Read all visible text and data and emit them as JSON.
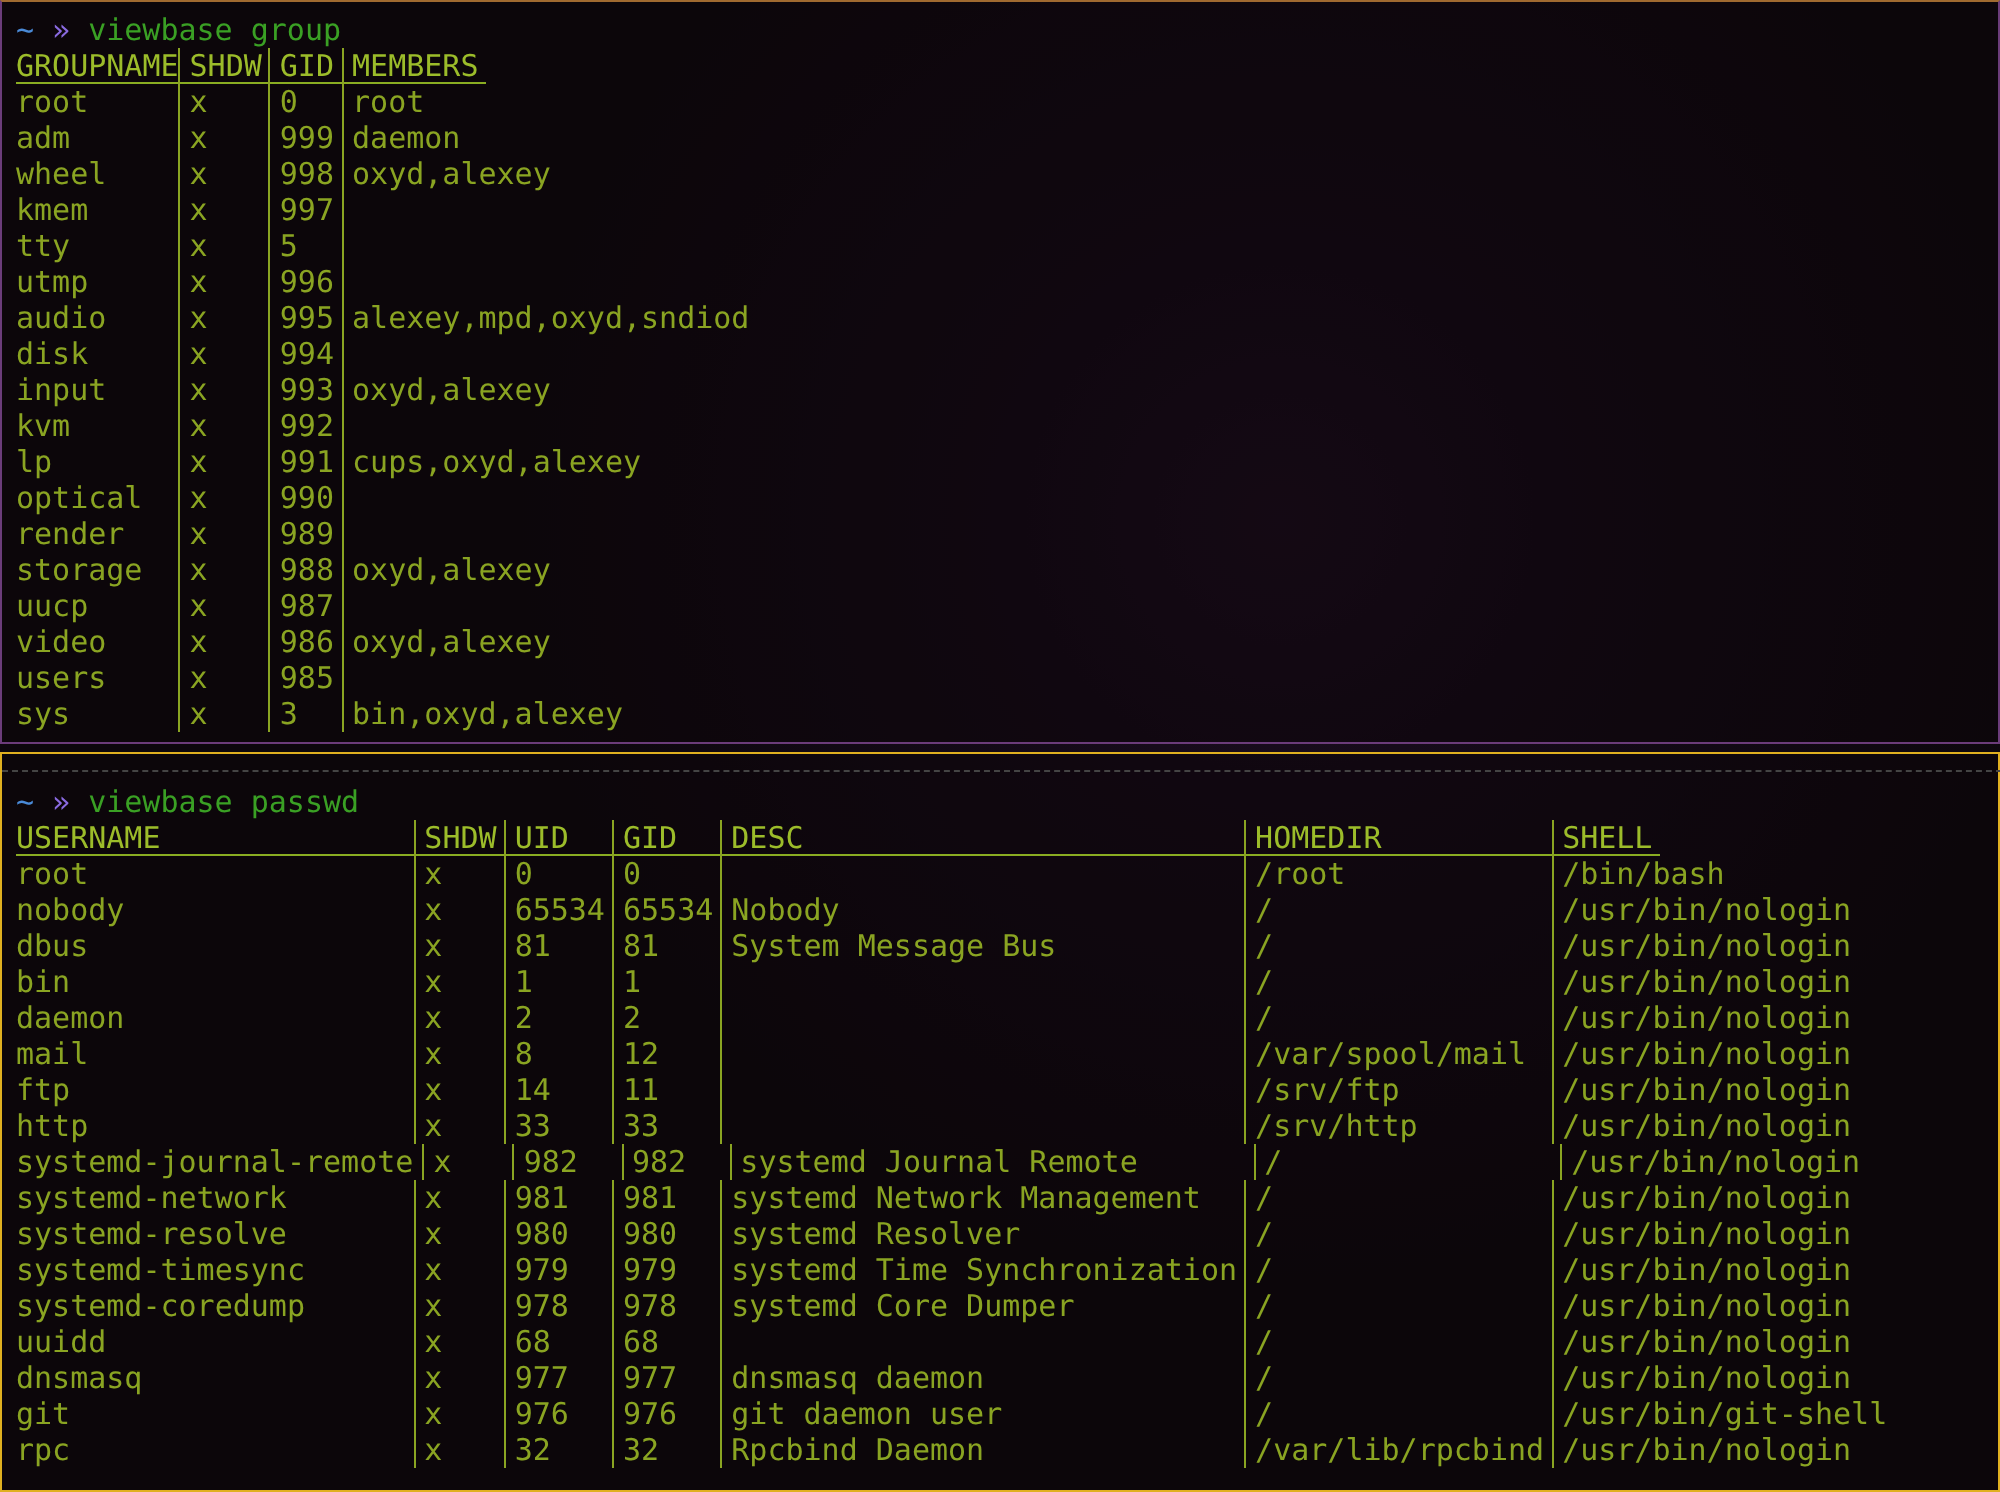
{
  "panes": [
    {
      "focused": false,
      "prompt": {
        "dir": "~",
        "symbol": "»",
        "command": "viewbase group"
      },
      "columns": [
        {
          "label": "GROUPNAME"
        },
        {
          "label": "SHDW"
        },
        {
          "label": "GID"
        },
        {
          "label": "MEMBERS"
        }
      ],
      "rows": [
        [
          "root",
          "x",
          "0",
          "root"
        ],
        [
          "adm",
          "x",
          "999",
          "daemon"
        ],
        [
          "wheel",
          "x",
          "998",
          "oxyd,alexey"
        ],
        [
          "kmem",
          "x",
          "997",
          null
        ],
        [
          "tty",
          "x",
          "5",
          null
        ],
        [
          "utmp",
          "x",
          "996",
          null
        ],
        [
          "audio",
          "x",
          "995",
          "alexey,mpd,oxyd,sndiod"
        ],
        [
          "disk",
          "x",
          "994",
          null
        ],
        [
          "input",
          "x",
          "993",
          "oxyd,alexey"
        ],
        [
          "kvm",
          "x",
          "992",
          null
        ],
        [
          "lp",
          "x",
          "991",
          "cups,oxyd,alexey"
        ],
        [
          "optical",
          "x",
          "990",
          null
        ],
        [
          "render",
          "x",
          "989",
          null
        ],
        [
          "storage",
          "x",
          "988",
          "oxyd,alexey"
        ],
        [
          "uucp",
          "x",
          "987",
          null
        ],
        [
          "video",
          "x",
          "986",
          "oxyd,alexey"
        ],
        [
          "users",
          "x",
          "985",
          null
        ],
        [
          "sys",
          "x",
          "3",
          "bin,oxyd,alexey"
        ]
      ]
    },
    {
      "focused": true,
      "prompt": {
        "dir": "~",
        "symbol": "»",
        "command": "viewbase passwd"
      },
      "columns": [
        {
          "label": "USERNAME"
        },
        {
          "label": "SHDW"
        },
        {
          "label": "UID"
        },
        {
          "label": "GID"
        },
        {
          "label": "DESC"
        },
        {
          "label": "HOMEDIR"
        },
        {
          "label": "SHELL"
        }
      ],
      "rows": [
        [
          "root",
          "x",
          "0",
          "0",
          null,
          "/root",
          "/bin/bash"
        ],
        [
          "nobody",
          "x",
          "65534",
          "65534",
          "Nobody",
          "/",
          "/usr/bin/nologin"
        ],
        [
          "dbus",
          "x",
          "81",
          "81",
          "System Message Bus",
          "/",
          "/usr/bin/nologin"
        ],
        [
          "bin",
          "x",
          "1",
          "1",
          null,
          "/",
          "/usr/bin/nologin"
        ],
        [
          "daemon",
          "x",
          "2",
          "2",
          null,
          "/",
          "/usr/bin/nologin"
        ],
        [
          "mail",
          "x",
          "8",
          "12",
          null,
          "/var/spool/mail",
          "/usr/bin/nologin"
        ],
        [
          "ftp",
          "x",
          "14",
          "11",
          null,
          "/srv/ftp",
          "/usr/bin/nologin"
        ],
        [
          "http",
          "x",
          "33",
          "33",
          null,
          "/srv/http",
          "/usr/bin/nologin"
        ],
        [
          "systemd-journal-remote",
          "x",
          "982",
          "982",
          "systemd Journal Remote",
          "/",
          "/usr/bin/nologin"
        ],
        [
          "systemd-network",
          "x",
          "981",
          "981",
          "systemd Network Management",
          "/",
          "/usr/bin/nologin"
        ],
        [
          "systemd-resolve",
          "x",
          "980",
          "980",
          "systemd Resolver",
          "/",
          "/usr/bin/nologin"
        ],
        [
          "systemd-timesync",
          "x",
          "979",
          "979",
          "systemd Time Synchronization",
          "/",
          "/usr/bin/nologin"
        ],
        [
          "systemd-coredump",
          "x",
          "978",
          "978",
          "systemd Core Dumper",
          "/",
          "/usr/bin/nologin"
        ],
        [
          "uuidd",
          "x",
          "68",
          "68",
          null,
          "/",
          "/usr/bin/nologin"
        ],
        [
          "dnsmasq",
          "x",
          "977",
          "977",
          "dnsmasq daemon",
          "/",
          "/usr/bin/nologin"
        ],
        [
          "git",
          "x",
          "976",
          "976",
          "git daemon user",
          "/",
          "/usr/bin/git-shell"
        ],
        [
          "rpc",
          "x",
          "32",
          "32",
          "Rpcbind Daemon",
          "/var/lib/rpcbind",
          "/usr/bin/nologin"
        ]
      ]
    }
  ]
}
